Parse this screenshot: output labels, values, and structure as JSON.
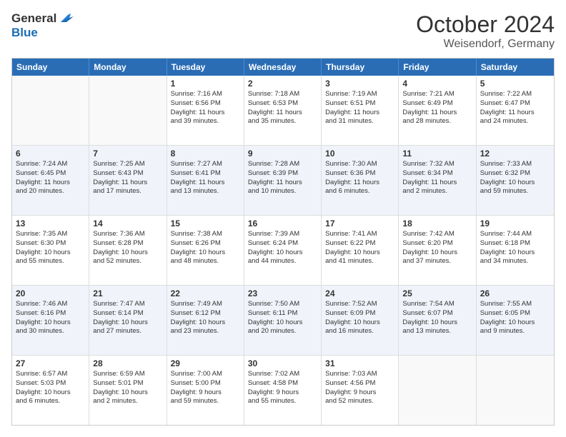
{
  "logo": {
    "line1": "General",
    "line2": "Blue"
  },
  "title": "October 2024",
  "location": "Weisendorf, Germany",
  "header_days": [
    "Sunday",
    "Monday",
    "Tuesday",
    "Wednesday",
    "Thursday",
    "Friday",
    "Saturday"
  ],
  "rows": [
    {
      "alt": false,
      "cells": [
        {
          "day": "",
          "lines": []
        },
        {
          "day": "",
          "lines": []
        },
        {
          "day": "1",
          "lines": [
            "Sunrise: 7:16 AM",
            "Sunset: 6:56 PM",
            "Daylight: 11 hours",
            "and 39 minutes."
          ]
        },
        {
          "day": "2",
          "lines": [
            "Sunrise: 7:18 AM",
            "Sunset: 6:53 PM",
            "Daylight: 11 hours",
            "and 35 minutes."
          ]
        },
        {
          "day": "3",
          "lines": [
            "Sunrise: 7:19 AM",
            "Sunset: 6:51 PM",
            "Daylight: 11 hours",
            "and 31 minutes."
          ]
        },
        {
          "day": "4",
          "lines": [
            "Sunrise: 7:21 AM",
            "Sunset: 6:49 PM",
            "Daylight: 11 hours",
            "and 28 minutes."
          ]
        },
        {
          "day": "5",
          "lines": [
            "Sunrise: 7:22 AM",
            "Sunset: 6:47 PM",
            "Daylight: 11 hours",
            "and 24 minutes."
          ]
        }
      ]
    },
    {
      "alt": true,
      "cells": [
        {
          "day": "6",
          "lines": [
            "Sunrise: 7:24 AM",
            "Sunset: 6:45 PM",
            "Daylight: 11 hours",
            "and 20 minutes."
          ]
        },
        {
          "day": "7",
          "lines": [
            "Sunrise: 7:25 AM",
            "Sunset: 6:43 PM",
            "Daylight: 11 hours",
            "and 17 minutes."
          ]
        },
        {
          "day": "8",
          "lines": [
            "Sunrise: 7:27 AM",
            "Sunset: 6:41 PM",
            "Daylight: 11 hours",
            "and 13 minutes."
          ]
        },
        {
          "day": "9",
          "lines": [
            "Sunrise: 7:28 AM",
            "Sunset: 6:39 PM",
            "Daylight: 11 hours",
            "and 10 minutes."
          ]
        },
        {
          "day": "10",
          "lines": [
            "Sunrise: 7:30 AM",
            "Sunset: 6:36 PM",
            "Daylight: 11 hours",
            "and 6 minutes."
          ]
        },
        {
          "day": "11",
          "lines": [
            "Sunrise: 7:32 AM",
            "Sunset: 6:34 PM",
            "Daylight: 11 hours",
            "and 2 minutes."
          ]
        },
        {
          "day": "12",
          "lines": [
            "Sunrise: 7:33 AM",
            "Sunset: 6:32 PM",
            "Daylight: 10 hours",
            "and 59 minutes."
          ]
        }
      ]
    },
    {
      "alt": false,
      "cells": [
        {
          "day": "13",
          "lines": [
            "Sunrise: 7:35 AM",
            "Sunset: 6:30 PM",
            "Daylight: 10 hours",
            "and 55 minutes."
          ]
        },
        {
          "day": "14",
          "lines": [
            "Sunrise: 7:36 AM",
            "Sunset: 6:28 PM",
            "Daylight: 10 hours",
            "and 52 minutes."
          ]
        },
        {
          "day": "15",
          "lines": [
            "Sunrise: 7:38 AM",
            "Sunset: 6:26 PM",
            "Daylight: 10 hours",
            "and 48 minutes."
          ]
        },
        {
          "day": "16",
          "lines": [
            "Sunrise: 7:39 AM",
            "Sunset: 6:24 PM",
            "Daylight: 10 hours",
            "and 44 minutes."
          ]
        },
        {
          "day": "17",
          "lines": [
            "Sunrise: 7:41 AM",
            "Sunset: 6:22 PM",
            "Daylight: 10 hours",
            "and 41 minutes."
          ]
        },
        {
          "day": "18",
          "lines": [
            "Sunrise: 7:42 AM",
            "Sunset: 6:20 PM",
            "Daylight: 10 hours",
            "and 37 minutes."
          ]
        },
        {
          "day": "19",
          "lines": [
            "Sunrise: 7:44 AM",
            "Sunset: 6:18 PM",
            "Daylight: 10 hours",
            "and 34 minutes."
          ]
        }
      ]
    },
    {
      "alt": true,
      "cells": [
        {
          "day": "20",
          "lines": [
            "Sunrise: 7:46 AM",
            "Sunset: 6:16 PM",
            "Daylight: 10 hours",
            "and 30 minutes."
          ]
        },
        {
          "day": "21",
          "lines": [
            "Sunrise: 7:47 AM",
            "Sunset: 6:14 PM",
            "Daylight: 10 hours",
            "and 27 minutes."
          ]
        },
        {
          "day": "22",
          "lines": [
            "Sunrise: 7:49 AM",
            "Sunset: 6:12 PM",
            "Daylight: 10 hours",
            "and 23 minutes."
          ]
        },
        {
          "day": "23",
          "lines": [
            "Sunrise: 7:50 AM",
            "Sunset: 6:11 PM",
            "Daylight: 10 hours",
            "and 20 minutes."
          ]
        },
        {
          "day": "24",
          "lines": [
            "Sunrise: 7:52 AM",
            "Sunset: 6:09 PM",
            "Daylight: 10 hours",
            "and 16 minutes."
          ]
        },
        {
          "day": "25",
          "lines": [
            "Sunrise: 7:54 AM",
            "Sunset: 6:07 PM",
            "Daylight: 10 hours",
            "and 13 minutes."
          ]
        },
        {
          "day": "26",
          "lines": [
            "Sunrise: 7:55 AM",
            "Sunset: 6:05 PM",
            "Daylight: 10 hours",
            "and 9 minutes."
          ]
        }
      ]
    },
    {
      "alt": false,
      "cells": [
        {
          "day": "27",
          "lines": [
            "Sunrise: 6:57 AM",
            "Sunset: 5:03 PM",
            "Daylight: 10 hours",
            "and 6 minutes."
          ]
        },
        {
          "day": "28",
          "lines": [
            "Sunrise: 6:59 AM",
            "Sunset: 5:01 PM",
            "Daylight: 10 hours",
            "and 2 minutes."
          ]
        },
        {
          "day": "29",
          "lines": [
            "Sunrise: 7:00 AM",
            "Sunset: 5:00 PM",
            "Daylight: 9 hours",
            "and 59 minutes."
          ]
        },
        {
          "day": "30",
          "lines": [
            "Sunrise: 7:02 AM",
            "Sunset: 4:58 PM",
            "Daylight: 9 hours",
            "and 55 minutes."
          ]
        },
        {
          "day": "31",
          "lines": [
            "Sunrise: 7:03 AM",
            "Sunset: 4:56 PM",
            "Daylight: 9 hours",
            "and 52 minutes."
          ]
        },
        {
          "day": "",
          "lines": []
        },
        {
          "day": "",
          "lines": []
        }
      ]
    }
  ]
}
